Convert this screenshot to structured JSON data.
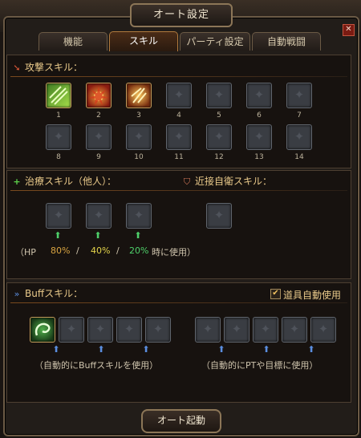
{
  "window": {
    "title": "オート設定",
    "close": "✕"
  },
  "tabs": [
    {
      "label": "機能"
    },
    {
      "label": "スキル"
    },
    {
      "label": "パーティ設定"
    },
    {
      "label": "自動戦闘"
    }
  ],
  "attack": {
    "header": "攻撃スキル：",
    "slots": [
      "1",
      "2",
      "3",
      "4",
      "5",
      "6",
      "7",
      "8",
      "9",
      "10",
      "11",
      "12",
      "13",
      "14"
    ]
  },
  "heal": {
    "header": "治療スキル（他人）：",
    "hp_prefix": "（HP",
    "p1": "80%",
    "sep1": "/",
    "p2": "40%",
    "sep2": "/",
    "p3": "20%",
    "suffix": "時に使用）",
    "colors": {
      "p1": "#d9a441",
      "p2": "#e3d34a",
      "p3": "#4ed06a"
    }
  },
  "defense": {
    "header": "近接自衛スキル："
  },
  "buff": {
    "header": "Buffスキル：",
    "auto_item_label": "道具自動使用",
    "auto_item_checked": "✔",
    "note_left": "（自動的にBuffスキルを使用）",
    "note_right": "（自動的にPTや目標に使用）"
  },
  "start_button": "オート起動",
  "icons": {
    "attack": "sword-arrow-icon",
    "heal": "plus-icon",
    "defense": "shield-icon",
    "buff": "double-arrow-icon"
  }
}
